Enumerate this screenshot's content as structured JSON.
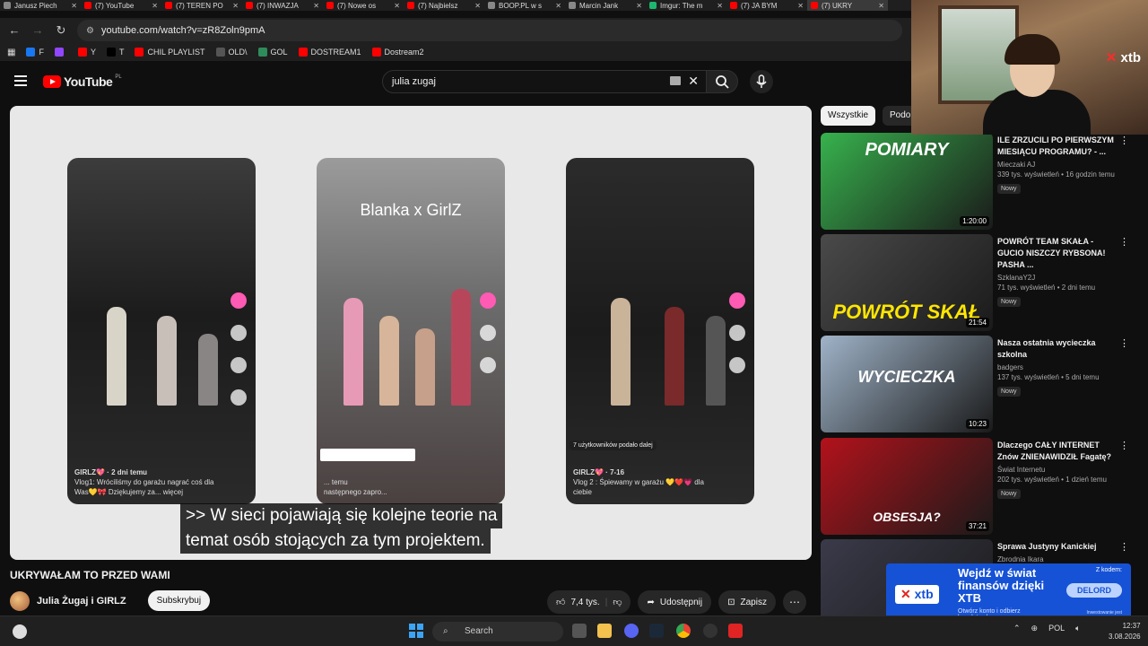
{
  "tabs": [
    {
      "label": "Janusz Piech",
      "color": "#888888"
    },
    {
      "label": "(7) YouTube",
      "color": "#ff0000"
    },
    {
      "label": "(7) TEREN PO",
      "color": "#ff0000"
    },
    {
      "label": "(7) INWAZJA",
      "color": "#ff0000"
    },
    {
      "label": "(7) Nowe os",
      "color": "#ff0000"
    },
    {
      "label": "(7) Najbielsz",
      "color": "#ff0000"
    },
    {
      "label": "BOOP.PL w s",
      "color": "#888888"
    },
    {
      "label": "Marcin Jank",
      "color": "#888888"
    },
    {
      "label": "Imgur: The m",
      "color": "#1bb76e"
    },
    {
      "label": "(7) JA BYM",
      "color": "#ff0000"
    },
    {
      "label": "(7) UKRY",
      "color": "#ff0000"
    }
  ],
  "address": {
    "url": "youtube.com/watch?v=zR8Zoln9pmA"
  },
  "bookmarks": [
    {
      "label": "F",
      "color": "#1877f2"
    },
    {
      "label": "",
      "color": "#9146ff"
    },
    {
      "label": "Y",
      "color": "#ff0000"
    },
    {
      "label": "T",
      "color": "#000000"
    },
    {
      "label": "CHIL PLAYLIST",
      "color": "#ff0000"
    },
    {
      "label": "OLD\\",
      "color": "#555555"
    },
    {
      "label": "GOL",
      "color": "#2d8c5a"
    },
    {
      "label": "DOSTREAM1",
      "color": "#ff0000"
    },
    {
      "label": "Dostream2",
      "color": "#ff0000"
    }
  ],
  "yt": {
    "brand": "YouTube",
    "country": "PL",
    "search_value": "julia zugaj"
  },
  "video": {
    "blanka": "Blanka x GirlZ",
    "phone1_user": "GIRLZ💖 · 2 dni temu",
    "phone1_caption": "Vlog1: Wróciliśmy do garażu nagrać coś dla Was💛🎀 Dziękujemy za... więcej",
    "phone2_time": "... temu",
    "phone2_caption": "następnego zapro...",
    "phone3_tag": "7 użytkowników podało dalej",
    "phone3_user": "GIRLZ💖 · 7-16",
    "phone3_caption": "Vlog 2 : Śpiewamy w garażu 💛❤️💗 dla ciebie",
    "subtitle_line1": ">> W sieci pojawiają się kolejne teorie na",
    "subtitle_line2": "temat osób stojących za tym projektem."
  },
  "title": "UKRYWAŁAM TO PRZED WAMI",
  "channel": {
    "name": "Julia Żugaj i GIRLZ",
    "subscribe": "Subskrybuj"
  },
  "actions": {
    "likes": "7,4 tys.",
    "share": "Udostępnij",
    "save": "Zapisz"
  },
  "chips": [
    "Wszystkie",
    "Podob"
  ],
  "recommendations": [
    {
      "title": "ILE ZRZUCILI PO PIERWSZYM MIESIĄCU PROGRAMU? - ...",
      "channel": "Mieczaki AJ",
      "views": "339 tys. wyświetleń • 16 godzin temu",
      "badge": "Nowy",
      "duration": "1:20:00",
      "thumb_text": "POMIARY",
      "thumb_bg": "#37b24d"
    },
    {
      "title": "POWRÓT TEAM SKAŁA - GUCIO NISZCZY RYBSONA! PASHA ...",
      "channel": "SzklanaY2J",
      "views": "71 tys. wyświetleń • 2 dni temu",
      "badge": "Nowy",
      "duration": "21:54",
      "thumb_text": "POWRÓT SKAŁ",
      "thumb_bg": "#4a4a4a"
    },
    {
      "title": "Nasza ostatnia wycieczka szkolna",
      "channel": "badgers",
      "views": "137 tys. wyświetleń • 5 dni temu",
      "badge": "Nowy",
      "duration": "10:23",
      "thumb_text": "WYCIECZKA",
      "thumb_bg": "#9fb3c8"
    },
    {
      "title": "Dlaczego CAŁY INTERNET Znów ZNIENAWIDZIŁ Fagatę?",
      "channel": "Świat Internetu",
      "views": "202 tys. wyświetleń • 1 dzień temu",
      "badge": "Nowy",
      "duration": "37:21",
      "thumb_text": "OBSESJA?",
      "thumb_bg": "#b3121b"
    },
    {
      "title": "Sprawa Justyny Kanickiej",
      "channel": "Zbrodnia Ikara",
      "views": "",
      "badge": "",
      "duration": "",
      "thumb_text": "",
      "thumb_bg": "#3a3a4a"
    }
  ],
  "webcam": {
    "brand": "xtb"
  },
  "ad": {
    "headline": "Wejdź w świat finansów dzięki XTB",
    "sub": "Otwórz konto i odbierz bezpłatny kurs",
    "code_label": "Z kodem:",
    "code": "DELORD",
    "disclaimer": "Inwestowanie jest ryzykowne. Inwestuj odpowiedzialnie.",
    "brand": "xtb"
  },
  "taskbar": {
    "search": "Search",
    "lang": "POL",
    "time": "12:37",
    "date": "3.08.2026"
  }
}
